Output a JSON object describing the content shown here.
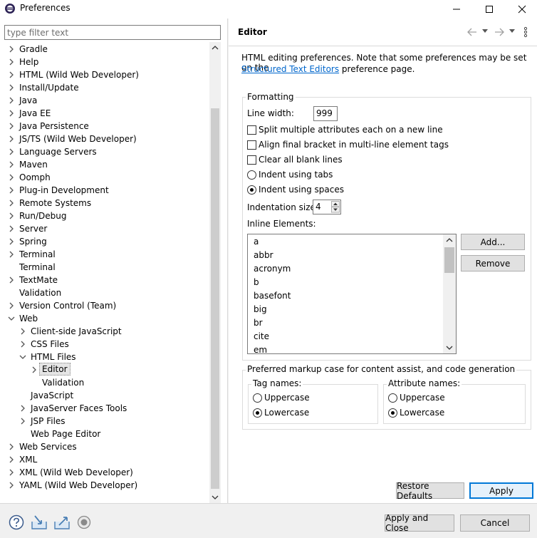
{
  "window": {
    "title": "Preferences"
  },
  "filter": {
    "placeholder": "type filter text"
  },
  "tree": {
    "items": [
      {
        "label": "Gradle"
      },
      {
        "label": "Help"
      },
      {
        "label": "HTML (Wild Web Developer)"
      },
      {
        "label": "Install/Update"
      },
      {
        "label": "Java"
      },
      {
        "label": "Java EE"
      },
      {
        "label": "Java Persistence"
      },
      {
        "label": "JS/TS (Wild Web Developer)"
      },
      {
        "label": "Language Servers"
      },
      {
        "label": "Maven"
      },
      {
        "label": "Oomph"
      },
      {
        "label": "Plug-in Development"
      },
      {
        "label": "Remote Systems"
      },
      {
        "label": "Run/Debug"
      },
      {
        "label": "Server"
      },
      {
        "label": "Spring"
      },
      {
        "label": "Terminal"
      },
      {
        "label": "Terminal"
      },
      {
        "label": "TextMate"
      },
      {
        "label": "Validation"
      },
      {
        "label": "Version Control (Team)"
      },
      {
        "label": "Web"
      },
      {
        "label": "Client-side JavaScript"
      },
      {
        "label": "CSS Files"
      },
      {
        "label": "HTML Files"
      },
      {
        "label": "Editor"
      },
      {
        "label": "Validation"
      },
      {
        "label": "JavaScript"
      },
      {
        "label": "JavaServer Faces Tools"
      },
      {
        "label": "JSP Files"
      },
      {
        "label": "Web Page Editor"
      },
      {
        "label": "Web Services"
      },
      {
        "label": "XML"
      },
      {
        "label": "XML (Wild Web Developer)"
      },
      {
        "label": "YAML (Wild Web Developer)"
      }
    ]
  },
  "editor": {
    "title": "Editor",
    "desc_line1": "HTML editing preferences.  Note that some preferences may be set on the",
    "desc_link": "Structured Text Editors",
    "desc_line2_rest": " preference page.",
    "formatting": {
      "title": "Formatting",
      "line_width_label": "Line width:",
      "line_width_value": "999",
      "split_attrs": "Split multiple attributes each on a new line",
      "align_bracket": "Align final bracket in multi-line element tags",
      "clear_blank": "Clear all blank lines",
      "indent_tabs": "Indent using tabs",
      "indent_spaces": "Indent using spaces",
      "indent_size_label": "Indentation size:",
      "indent_size_value": "4",
      "inline_label": "Inline Elements:",
      "inline_items": [
        "a",
        "abbr",
        "acronym",
        "b",
        "basefont",
        "big",
        "br",
        "cite",
        "em"
      ],
      "add_button": "Add...",
      "remove_button": "Remove"
    },
    "markup_case": {
      "title": "Preferred markup case for content assist, and code generation",
      "tag_title": "Tag names:",
      "attr_title": "Attribute names:",
      "upper": "Uppercase",
      "lower": "Lowercase"
    },
    "restore_defaults": "Restore Defaults",
    "apply": "Apply"
  },
  "footer": {
    "apply_close": "Apply and Close",
    "cancel": "Cancel"
  }
}
